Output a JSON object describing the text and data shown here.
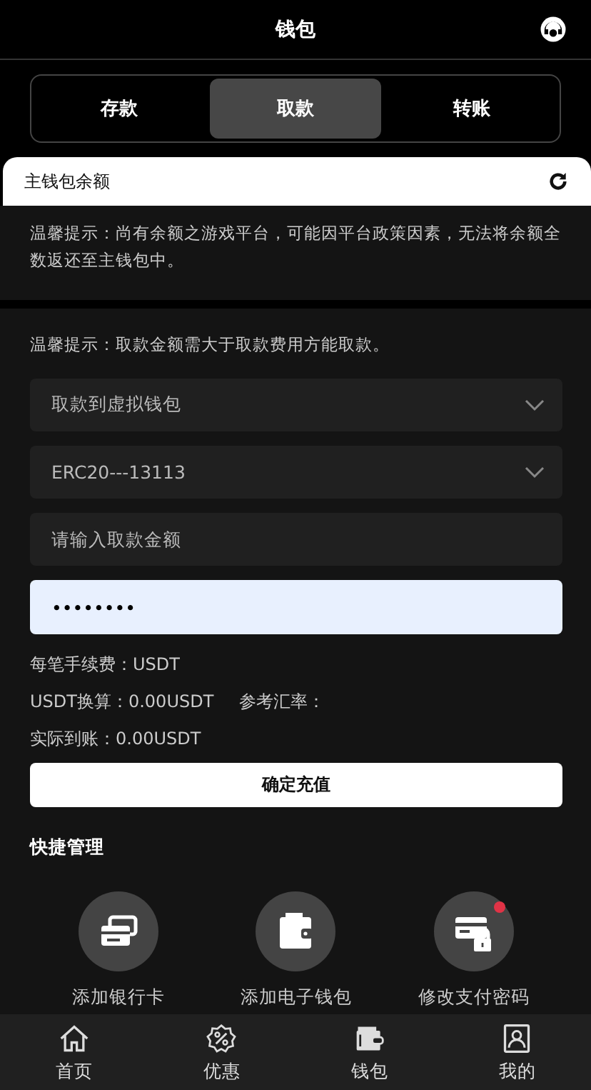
{
  "header": {
    "title": "钱包"
  },
  "tabs": [
    {
      "label": "存款",
      "selected": false
    },
    {
      "label": "取款",
      "selected": true
    },
    {
      "label": "转账",
      "selected": false
    }
  ],
  "balance": {
    "label": "主钱包余额"
  },
  "notice": "温馨提示：尚有余额之游戏平台，可能因平台政策因素，无法将余额全数返还至主钱包中。",
  "form": {
    "hint": "温馨提示：取款金额需大于取款费用方能取款。",
    "fields": [
      {
        "kind": "select",
        "value": "取款到虚拟钱包"
      },
      {
        "kind": "select",
        "value": "ERC20---13113"
      },
      {
        "kind": "input",
        "placeholder": "请输入取款金额"
      },
      {
        "kind": "password",
        "value": "••••••••"
      }
    ],
    "fee": "每笔手续费：USDT",
    "conversion": "USDT换算：0.00USDT",
    "rate": "参考汇率：",
    "actual": "实际到账：0.00USDT",
    "submit": "确定充值"
  },
  "quick": {
    "title": "快捷管理",
    "items": [
      {
        "kind": "bank-card",
        "label": "添加银行卡",
        "alert": false
      },
      {
        "kind": "wallet",
        "label": "添加电子钱包",
        "alert": false
      },
      {
        "kind": "lock-card",
        "label": "修改支付密码",
        "alert": true
      }
    ]
  },
  "nav": [
    {
      "kind": "home",
      "label": "首页"
    },
    {
      "kind": "promo",
      "label": "优惠"
    },
    {
      "kind": "wallet",
      "label": "钱包"
    },
    {
      "kind": "profile",
      "label": "我的"
    }
  ]
}
